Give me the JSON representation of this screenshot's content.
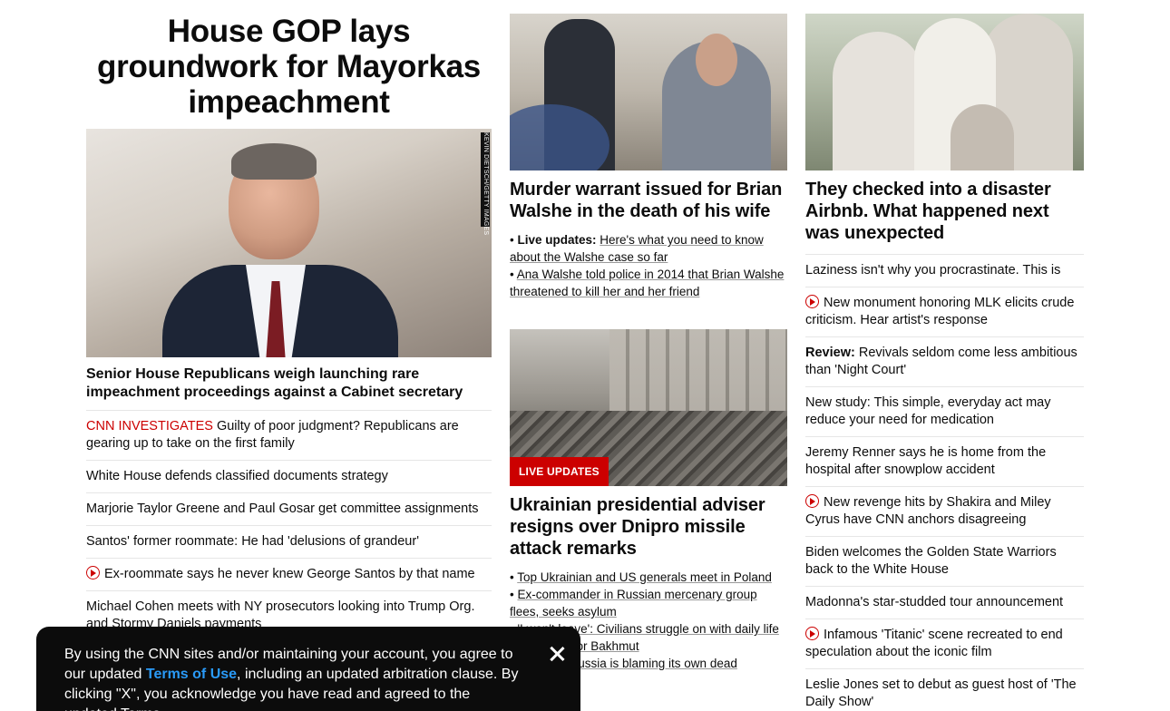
{
  "lead": {
    "headline": "House GOP lays groundwork for Mayorkas impeachment",
    "image_credit": "KEVIN DIETSCH/GETTY IMAGES",
    "subhead": "Senior House Republicans weigh launching rare impeachment proceedings against a Cabinet secretary",
    "items": [
      {
        "tag": "CNN INVESTIGATES",
        "text": " Guilty of poor judgment? Republicans are gearing up to take on the first family"
      },
      {
        "text": "White House defends classified documents strategy"
      },
      {
        "text": "Marjorie Taylor Greene and Paul Gosar get committee assignments"
      },
      {
        "text": "Santos' former roommate: He had 'delusions of grandeur'"
      },
      {
        "video": true,
        "text": "Ex-roommate says he never knew George Santos by that name"
      },
      {
        "text": "Michael Cohen meets with NY prosecutors looking into Trump Org. and Stormy Daniels payments"
      }
    ]
  },
  "walshe": {
    "headline": "Murder warrant issued for Brian Walshe in the death of his wife",
    "bullet1_label": "Live updates:",
    "bullet1_text": "Here's what you need to know about the Walshe case so far",
    "bullet2_text": "Ana Walshe told police in 2014 that Brian Walshe threatened to kill her and her friend"
  },
  "ukraine": {
    "badge": "LIVE UPDATES",
    "headline": "Ukrainian presidential adviser resigns over Dnipro missile attack remarks",
    "bullets": [
      "Top Ukrainian and US generals meet in Poland",
      "Ex-commander in Russian mercenary group flees, seeks asylum",
      "'I won't leave': Civilians struggle on with daily life amid battle for Bakhmut",
      "Analysis: Russia is blaming its own dead"
    ]
  },
  "airbnb": {
    "headline": "They checked into a disaster Airbnb. What happened next was unexpected",
    "items": [
      {
        "text": "Laziness isn't why you procrastinate. This is"
      },
      {
        "video": true,
        "text": "New monument honoring MLK elicits crude criticism. Hear artist's response"
      },
      {
        "bold": "Review:",
        "text": " Revivals seldom come less ambitious than 'Night Court'"
      },
      {
        "text": "New study: This simple, everyday act may reduce your need for medication"
      },
      {
        "text": "Jeremy Renner says he is home from the hospital after snowplow accident"
      },
      {
        "video": true,
        "text": "New revenge hits by Shakira and Miley Cyrus have CNN anchors disagreeing"
      },
      {
        "text": "Biden welcomes the Golden State Warriors back to the White House"
      },
      {
        "text": "Madonna's star-studded tour announcement"
      },
      {
        "video": true,
        "text": "Infamous 'Titanic' scene recreated to end speculation about the iconic film"
      },
      {
        "text": "Leslie Jones set to debut as guest host of 'The Daily Show'"
      }
    ]
  },
  "cookie": {
    "text_before": "By using the CNN sites and/or maintaining your account, you agree to our updated ",
    "terms_link": "Terms of Use",
    "text_after": ", including an updated arbitration clause. By clicking \"X\", you acknowledge you have read and agreed to the updated Terms.",
    "close_icon": "close-icon"
  }
}
